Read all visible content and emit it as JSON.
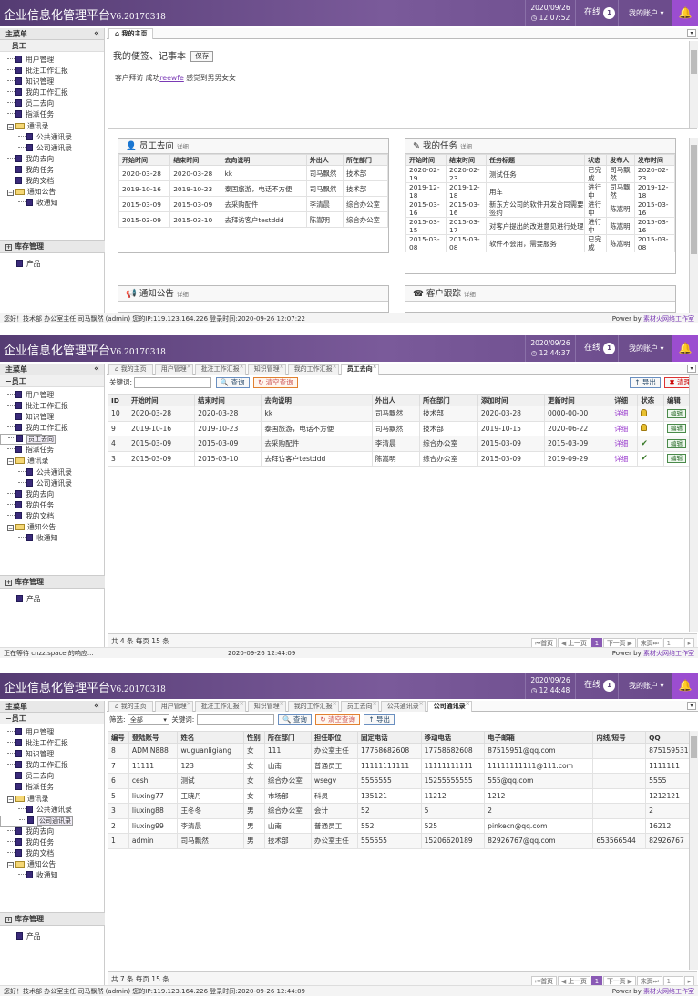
{
  "app": {
    "brand": "企业信息化管理平台",
    "version": "V6.20170318",
    "online_label": "在线",
    "online_count": "1",
    "account_label": "我的账户",
    "sidebar_title": "主菜单",
    "sidebar_collapse": "«",
    "group_employee": "员工",
    "group_inventory": "库存管理",
    "inventory_item": "产品",
    "power_by": "Power by",
    "power_link": "素材火网络工作室",
    "menu": [
      {
        "label": "用户管理",
        "level": 1,
        "type": "doc"
      },
      {
        "label": "批注工作汇报",
        "level": 1,
        "type": "doc"
      },
      {
        "label": "知识管理",
        "level": 1,
        "type": "doc"
      },
      {
        "label": "我的工作汇报",
        "level": 1,
        "type": "doc"
      },
      {
        "label": "员工去向",
        "level": 1,
        "type": "doc"
      },
      {
        "label": "指派任务",
        "level": 1,
        "type": "doc"
      },
      {
        "label": "通讯录",
        "level": 1,
        "type": "folder"
      },
      {
        "label": "公共通讯录",
        "level": 2,
        "type": "doc"
      },
      {
        "label": "公司通讯录",
        "level": 2,
        "type": "doc"
      },
      {
        "label": "我的去向",
        "level": 1,
        "type": "doc"
      },
      {
        "label": "我的任务",
        "level": 1,
        "type": "doc"
      },
      {
        "label": "我的文档",
        "level": 1,
        "type": "doc"
      },
      {
        "label": "通知公告",
        "level": 1,
        "type": "folder"
      },
      {
        "label": "收通知",
        "level": 2,
        "type": "doc"
      }
    ]
  },
  "shot1": {
    "date": "2020/09/26",
    "time": "12:07:52",
    "tab": "我的主页",
    "note_title": "我的便签、记事本",
    "save_label": "保存",
    "note_text_a": "客户拜访 成功",
    "note_link": "reewfe",
    "note_text_b": " 感觉到男男女女",
    "panel_dir_title": "员工去向",
    "panel_task_title": "我的任务",
    "panel_notice_title": "通知公告",
    "panel_client_title": "客户跟踪",
    "more": "详细",
    "dir_headers": [
      "开始时间",
      "结束时间",
      "去向说明",
      "外出人",
      "所在部门"
    ],
    "dir_rows": [
      [
        "2020-03-28",
        "2020-03-28",
        "kk",
        "司马飘然",
        "技术部"
      ],
      [
        "2019-10-16",
        "2019-10-23",
        "泰国旅游，电话不方便",
        "司马飘然",
        "技术部"
      ],
      [
        "2015-03-09",
        "2015-03-09",
        "去采购配件",
        "李清晨",
        "综合办公室"
      ],
      [
        "2015-03-09",
        "2015-03-10",
        "去拜访客户testddd",
        "陈嵩明",
        "综合办公室"
      ]
    ],
    "task_headers": [
      "开始时间",
      "结束时间",
      "任务标题",
      "状态",
      "发布人",
      "发布时间"
    ],
    "task_rows": [
      [
        "2020-02-19",
        "2020-02-23",
        "测试任务",
        "已完成",
        "司马飘然",
        "2020-02-23"
      ],
      [
        "2019-12-18",
        "2019-12-18",
        "用车",
        "进行中",
        "司马飘然",
        "2019-12-18"
      ],
      [
        "2015-03-16",
        "2015-03-16",
        "新东方公司的软件开发合同需要签约",
        "进行中",
        "陈嵩明",
        "2015-03-16"
      ],
      [
        "2015-03-15",
        "2015-03-17",
        "对客户提出的改进意见进行处理",
        "进行中",
        "陈嵩明",
        "2015-03-16"
      ],
      [
        "2015-03-08",
        "2015-03-08",
        "软件不会用，需要服务",
        "已完成",
        "陈嵩明",
        "2015-03-08"
      ]
    ],
    "status": "您好！技术部 办公室主任 司马飘然 (admin) 您的IP:119.123.164.226 登录时间:2020-09-26 12:07:22"
  },
  "shot2": {
    "date": "2020/09/26",
    "time": "12:44:37",
    "tabs": [
      "我的主页",
      "用户管理",
      "批注工作汇报",
      "知识管理",
      "我的工作汇报",
      "员工去向"
    ],
    "keyword_label": "关键词:",
    "query_label": "查询",
    "clear_label": "清空查询",
    "export_label": "导出",
    "clean_label": "清理",
    "headers": [
      "ID",
      "开始时间",
      "结束时间",
      "去向说明",
      "外出人",
      "所在部门",
      "添加时间",
      "更新时间",
      "详细",
      "状态",
      "编辑"
    ],
    "rows": [
      {
        "id": "10",
        "start": "2020-03-28",
        "end": "2020-03-28",
        "desc": "kk",
        "person": "司马飘然",
        "dept": "技术部",
        "added": "2020-03-28",
        "updated": "0000-00-00",
        "detail": "详细",
        "status": "lock",
        "edit": "编辑"
      },
      {
        "id": "9",
        "start": "2019-10-16",
        "end": "2019-10-23",
        "desc": "泰国旅游，电话不方便",
        "person": "司马飘然",
        "dept": "技术部",
        "added": "2019-10-15",
        "updated": "2020-06-22",
        "detail": "详细",
        "status": "lock",
        "edit": "编辑"
      },
      {
        "id": "4",
        "start": "2015-03-09",
        "end": "2015-03-09",
        "desc": "去采购配件",
        "person": "李清晨",
        "dept": "综合办公室",
        "added": "2015-03-09",
        "updated": "2015-03-09",
        "detail": "详细",
        "status": "ok",
        "edit": "编辑"
      },
      {
        "id": "3",
        "start": "2015-03-09",
        "end": "2015-03-10",
        "desc": "去拜访客户testddd",
        "person": "陈嵩明",
        "dept": "综合办公室",
        "added": "2015-03-09",
        "updated": "2019-09-29",
        "detail": "详细",
        "status": "ok",
        "edit": "编辑"
      }
    ],
    "pager_total": "共 4 条 每页 15 条",
    "pager": {
      "first": "首页",
      "prev": "上一页",
      "cur": "1",
      "next": "下一页",
      "last": "末页",
      "input": "1"
    },
    "status_left": "正在等待 cnzz.space 的响应...",
    "status_time": "2020-09-26 12:44:09"
  },
  "shot3": {
    "date": "2020/09/26",
    "time": "12:44:48",
    "tabs": [
      "我的主页",
      "用户管理",
      "批注工作汇报",
      "知识管理",
      "我的工作汇报",
      "员工去向",
      "公共通讯录",
      "公司通讯录"
    ],
    "filter_label": "筛选:",
    "filter_value": "全部",
    "keyword_label": "关键词:",
    "query_label": "查询",
    "clear_label": "清空查询",
    "export_label": "导出",
    "headers": [
      "编号",
      "登陆账号",
      "姓名",
      "性别",
      "所在部门",
      "担任职位",
      "固定电话",
      "移动电话",
      "电子邮箱",
      "内线/短号",
      "QQ"
    ],
    "rows": [
      [
        "8",
        "ADMIN888",
        "wuguanligiang",
        "女",
        "111",
        "办公室主任",
        "17758682608",
        "17758682608",
        "87515951@qq.com",
        "",
        "875159531"
      ],
      [
        "7",
        "11111",
        "123",
        "女",
        "山南",
        "普通员工",
        "11111111111",
        "11111111111",
        "11111111111@111.com",
        "",
        "1111111"
      ],
      [
        "6",
        "ceshi",
        "测试",
        "女",
        "综合办公室",
        "wsegv",
        "5555555",
        "15255555555",
        "555@qq.com",
        "",
        "5555"
      ],
      [
        "5",
        "liuxing77",
        "王晓丹",
        "女",
        "市场部",
        "科员",
        "135121",
        "11212",
        "1212",
        "",
        "1212121"
      ],
      [
        "3",
        "liuxing88",
        "王冬冬",
        "男",
        "综合办公室",
        "会计",
        "52",
        "5",
        "2",
        "",
        "2"
      ],
      [
        "2",
        "liuxing99",
        "李清晨",
        "男",
        "山南",
        "普通员工",
        "552",
        "525",
        "pinkecn@qq.com",
        "",
        "16212"
      ],
      [
        "1",
        "admin",
        "司马飘然",
        "男",
        "技术部",
        "办公室主任",
        "555555",
        "15206620189",
        "82926767@qq.com",
        "653566544",
        "82926767"
      ]
    ],
    "pager_total": "共 7 条 每页 15 条",
    "status": "您好！技术部 办公室主任 司马飘然 (admin) 您的IP:119.123.164.226 登录时间:2020-09-26 12:44:09"
  }
}
